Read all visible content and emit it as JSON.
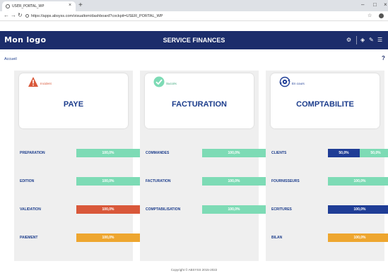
{
  "browser": {
    "tab_title": "USER_PORTAL_WP",
    "url": "https://apps.absyss.com/visualtom/dashboard?cockpit=USER_PORTAL_WP"
  },
  "app": {
    "logo": "Mon logo",
    "title": "SERVICE FINANCES",
    "breadcrumb": "Accueil",
    "help": "?"
  },
  "colors": {
    "header": "#1c2d6b",
    "ok_green": "#7ddbb5",
    "error_red": "#d9583a",
    "warn_orange": "#eea62f",
    "dark_blue": "#1f3d96",
    "label_blue": "#1c3d8c"
  },
  "panels": [
    {
      "title": "PAYE",
      "status_label": "Incident",
      "status_icon": "warning-triangle-icon",
      "rows": [
        {
          "label": "PREPARATION",
          "segments": [
            {
              "text": "100,0%",
              "fraction": 1.0,
              "color": "#7ddbb5"
            }
          ]
        },
        {
          "label": "EDITION",
          "segments": [
            {
              "text": "100,0%",
              "fraction": 1.0,
              "color": "#7ddbb5"
            }
          ]
        },
        {
          "label": "VALIDATION",
          "segments": [
            {
              "text": "100,0%",
              "fraction": 1.0,
              "color": "#d9583a"
            }
          ]
        },
        {
          "label": "PAIEMENT",
          "segments": [
            {
              "text": "100,0%",
              "fraction": 1.0,
              "color": "#eea62f"
            }
          ]
        }
      ]
    },
    {
      "title": "FACTURATION",
      "status_label": "Succès",
      "status_icon": "check-circle-icon",
      "rows": [
        {
          "label": "COMMANDES",
          "segments": [
            {
              "text": "100,0%",
              "fraction": 1.0,
              "color": "#7ddbb5"
            }
          ]
        },
        {
          "label": "FACTURATION",
          "segments": [
            {
              "text": "100,0%",
              "fraction": 1.0,
              "color": "#7ddbb5"
            }
          ]
        },
        {
          "label": "COMPTABILISATION",
          "segments": [
            {
              "text": "100,0%",
              "fraction": 1.0,
              "color": "#7ddbb5"
            }
          ]
        }
      ]
    },
    {
      "title": "COMPTABILITE",
      "status_label": "En cours",
      "status_icon": "sync-gear-icon",
      "rows": [
        {
          "label": "CLIENTS",
          "segments": [
            {
              "text": "50,0%",
              "fraction": 0.5,
              "color": "#1f3d96"
            },
            {
              "text": "50,0%",
              "fraction": 0.5,
              "color": "#7ddbb5"
            }
          ]
        },
        {
          "label": "FOURNISSEURS",
          "segments": [
            {
              "text": "100,0%",
              "fraction": 1.0,
              "color": "#7ddbb5"
            }
          ]
        },
        {
          "label": "ECRITURES",
          "segments": [
            {
              "text": "100,0%",
              "fraction": 1.0,
              "color": "#1f3d96"
            }
          ]
        },
        {
          "label": "BILAN",
          "segments": [
            {
              "text": "100,0%",
              "fraction": 1.0,
              "color": "#eea62f"
            }
          ]
        }
      ]
    }
  ],
  "footer": "Copyright © ABSYSS 2015-2022"
}
